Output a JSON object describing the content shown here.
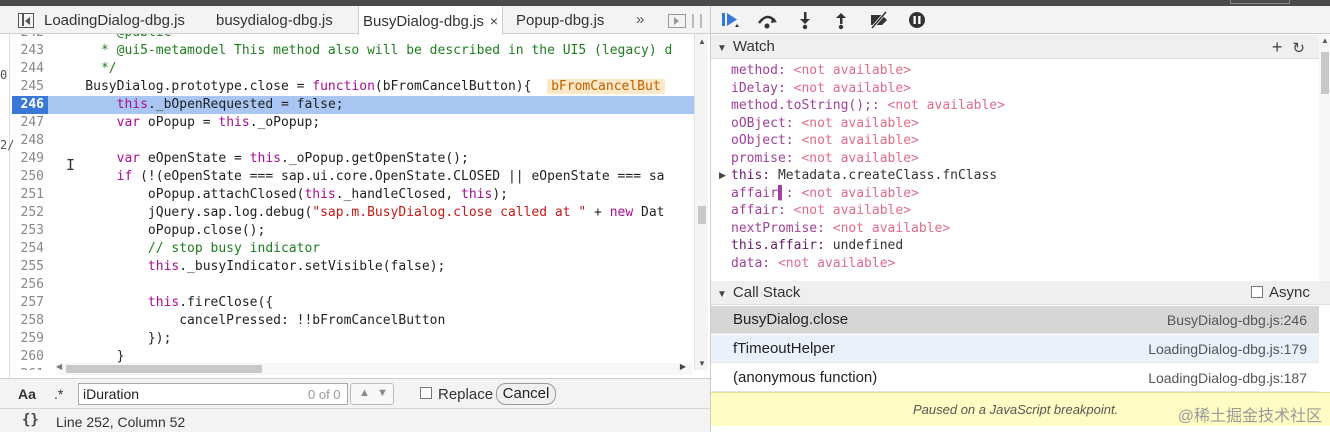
{
  "tabs": [
    {
      "label": "LoadingDialog-dbg.js",
      "active": false
    },
    {
      "label": "busydialog-dbg.js",
      "active": false
    },
    {
      "label": "BusyDialog-dbg.js",
      "active": true
    },
    {
      "label": "Popup-dbg.js",
      "active": false
    }
  ],
  "tab_close": "×",
  "tab_more": "»",
  "gutter_chars": [
    "0",
    "2/"
  ],
  "code_lines": [
    {
      "num": "242",
      "text": "      * @public"
    },
    {
      "num": "243",
      "text": "      * @ui5-metamodel This method also will be described in the UI5 (legacy) d"
    },
    {
      "num": "244",
      "text": "      */"
    },
    {
      "num": "245",
      "text": "    BusyDialog.prototype.close = function(bFromCancelButton){  ",
      "inline": "bFromCancelBut"
    },
    {
      "num": "246",
      "text": "        this._bOpenRequested = false;",
      "current": true
    },
    {
      "num": "247",
      "text": "        var oPopup = this._oPopup;"
    },
    {
      "num": "248",
      "text": ""
    },
    {
      "num": "249",
      "text": "        var eOpenState = this._oPopup.getOpenState();"
    },
    {
      "num": "250",
      "text": "        if (!(eOpenState === sap.ui.core.OpenState.CLOSED || eOpenState === sa"
    },
    {
      "num": "251",
      "text": "            oPopup.attachClosed(this._handleClosed, this);"
    },
    {
      "num": "252",
      "text": "            jQuery.sap.log.debug(\"sap.m.BusyDialog.close called at \" + new Dat"
    },
    {
      "num": "253",
      "text": "            oPopup.close();"
    },
    {
      "num": "254",
      "text": "            // stop busy indicator"
    },
    {
      "num": "255",
      "text": "            this._busyIndicator.setVisible(false);"
    },
    {
      "num": "256",
      "text": ""
    },
    {
      "num": "257",
      "text": "            this.fireClose({"
    },
    {
      "num": "258",
      "text": "                cancelPressed: !!bFromCancelButton"
    },
    {
      "num": "259",
      "text": "            });"
    },
    {
      "num": "260",
      "text": "        }"
    },
    {
      "num": "261",
      "text": ""
    }
  ],
  "search": {
    "case_label": "Aa",
    "regex_label": ".*",
    "value": "iDuration",
    "count": "0 of 0",
    "replace_label": "Replace",
    "cancel_label": "Cancel"
  },
  "status": {
    "braces": "{}",
    "position": "Line 252, Column 52"
  },
  "watch": {
    "title": "Watch",
    "add": "+",
    "refresh": "↻",
    "items": [
      {
        "expr": "method",
        "sep": ": ",
        "value": "<not available>",
        "na": true
      },
      {
        "expr": "iDelay",
        "sep": ": ",
        "value": "<not available>",
        "na": true
      },
      {
        "expr": "method.toString();",
        "sep": ": ",
        "value": "<not available>",
        "na": true
      },
      {
        "expr": "oOBject",
        "sep": ": ",
        "value": "<not available>",
        "na": true
      },
      {
        "expr": "oObject",
        "sep": ": ",
        "value": "<not available>",
        "na": true
      },
      {
        "expr": "promise",
        "sep": ": ",
        "value": "<not available>",
        "na": true
      },
      {
        "expr": "this",
        "sep": ": ",
        "value": "Metadata.createClass.fnClass",
        "na": false,
        "expandable": true
      },
      {
        "expr": "affair▌",
        "sep": ": ",
        "value": "<not available>",
        "na": true
      },
      {
        "expr": "affair",
        "sep": ": ",
        "value": "<not available>",
        "na": true
      },
      {
        "expr": "nextPromise",
        "sep": ": ",
        "value": "<not available>",
        "na": true
      },
      {
        "expr": "this.affair",
        "sep": ": ",
        "value": "undefined",
        "na": false
      },
      {
        "expr": "data",
        "sep": ": ",
        "value": "<not available>",
        "na": true
      }
    ]
  },
  "callstack": {
    "title": "Call Stack",
    "async_label": "Async",
    "frames": [
      {
        "fn": "BusyDialog.close",
        "loc": "BusyDialog-dbg.js:246",
        "state": "selected"
      },
      {
        "fn": "fTimeoutHelper",
        "loc": "LoadingDialog-dbg.js:179",
        "state": "hover"
      },
      {
        "fn": "(anonymous function)",
        "loc": "LoadingDialog-dbg.js:187",
        "state": ""
      }
    ]
  },
  "paused_message": "Paused on a JavaScript breakpoint.",
  "watermark": "@稀土掘金技术社区"
}
